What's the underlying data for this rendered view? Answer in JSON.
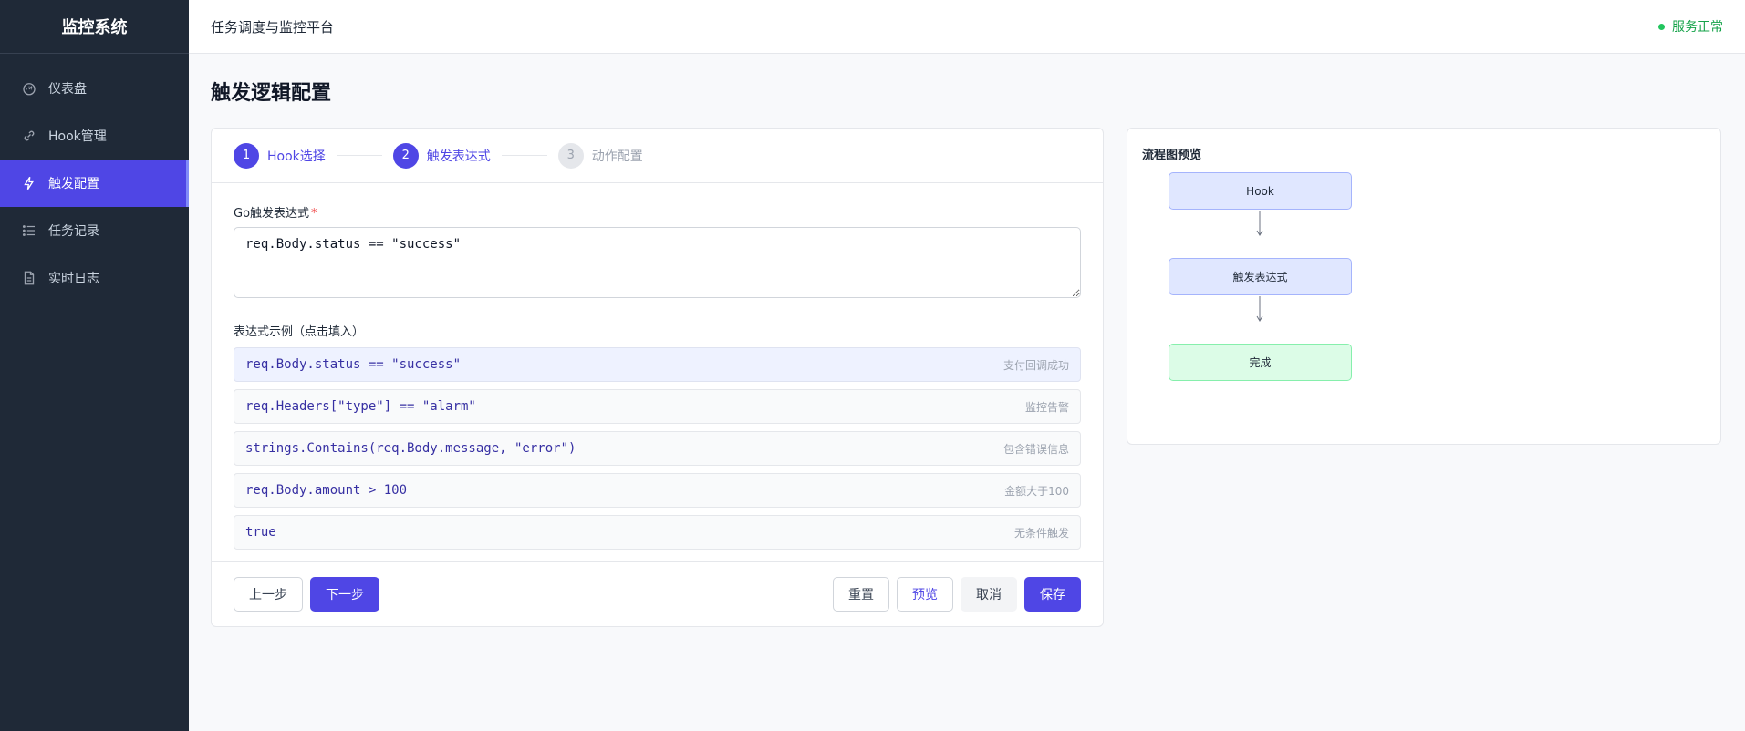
{
  "sidebar": {
    "brand": "监控系统",
    "items": [
      {
        "label": "仪表盘",
        "icon": "dashboard-icon",
        "active": false
      },
      {
        "label": "Hook管理",
        "icon": "link-icon",
        "active": false
      },
      {
        "label": "触发配置",
        "icon": "bolt-icon",
        "active": true
      },
      {
        "label": "任务记录",
        "icon": "list-icon",
        "active": false
      },
      {
        "label": "实时日志",
        "icon": "document-icon",
        "active": false
      }
    ]
  },
  "header": {
    "title": "任务调度与监控平台",
    "status": "服务正常",
    "status_color": "#22c55e"
  },
  "page": {
    "title": "触发逻辑配置"
  },
  "steps": [
    {
      "num": "1",
      "label": "Hook选择",
      "state": "done"
    },
    {
      "num": "2",
      "label": "触发表达式",
      "state": "current"
    },
    {
      "num": "3",
      "label": "动作配置",
      "state": "pending"
    }
  ],
  "form": {
    "expr_label": "Go触发表达式",
    "required_mark": "*",
    "expr_value": "req.Body.status == \"success\"",
    "examples_label": "表达式示例（点击填入）",
    "examples": [
      {
        "code": "req.Body.status == \"success\"",
        "desc": "支付回调成功",
        "selected": true
      },
      {
        "code": "req.Headers[\"type\"] == \"alarm\"",
        "desc": "监控告警",
        "selected": false
      },
      {
        "code": "strings.Contains(req.Body.message, \"error\")",
        "desc": "包含错误信息",
        "selected": false
      },
      {
        "code": "req.Body.amount > 100",
        "desc": "金额大于100",
        "selected": false
      },
      {
        "code": "true",
        "desc": "无条件触发",
        "selected": false
      }
    ]
  },
  "actions": {
    "prev": "上一步",
    "next": "下一步",
    "reset": "重置",
    "preview": "预览",
    "cancel": "取消",
    "save": "保存"
  },
  "preview": {
    "title": "流程图预览",
    "nodes": [
      "Hook",
      "触发表达式",
      "完成"
    ]
  },
  "colors": {
    "accent": "#4f46e5",
    "sidebar_bg": "#1f2937",
    "success": "#16a34a"
  }
}
